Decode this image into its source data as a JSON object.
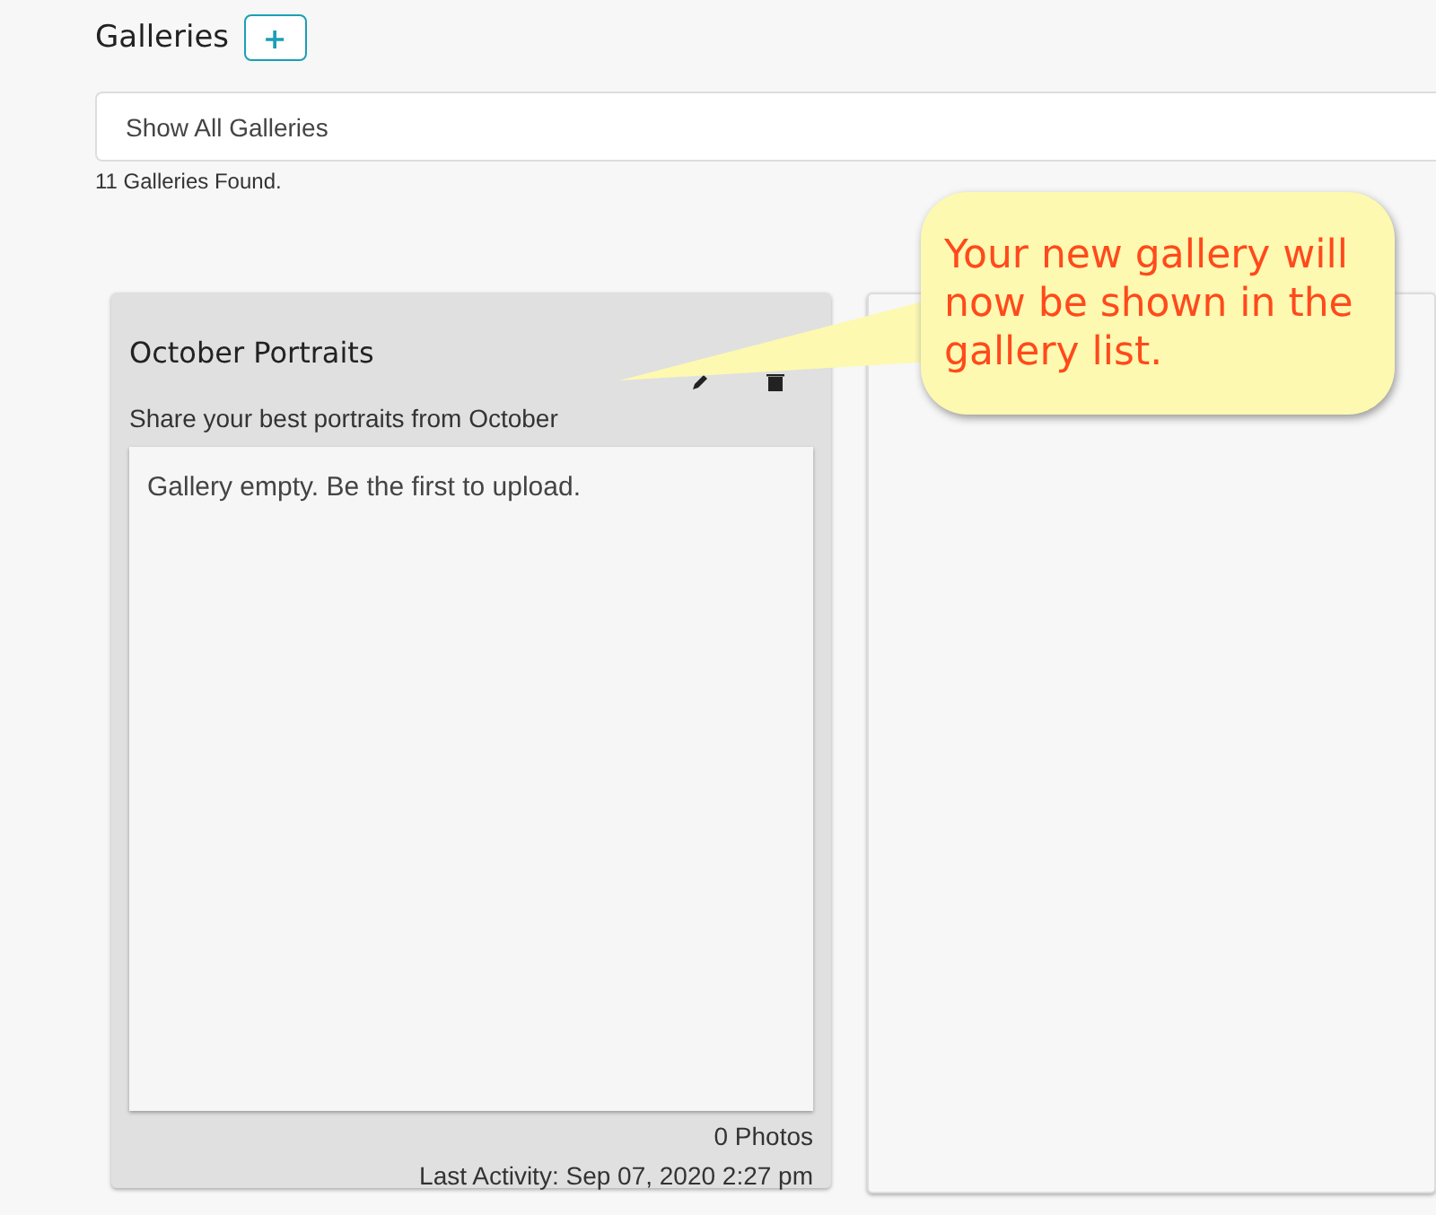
{
  "header": {
    "title": "Galleries",
    "add_button": "+"
  },
  "filter": {
    "value": "Show All Galleries"
  },
  "count": "11 Galleries Found.",
  "galleries": [
    {
      "title": "October Portraits",
      "description": "Share your best portraits from October",
      "empty_message": "Gallery empty. Be the first to upload.",
      "photos": "0 Photos",
      "last_activity": "Last Activity: Sep 07, 2020 2:27 pm"
    }
  ],
  "callout": {
    "text": "Your new gallery will now be shown in the gallery list."
  }
}
